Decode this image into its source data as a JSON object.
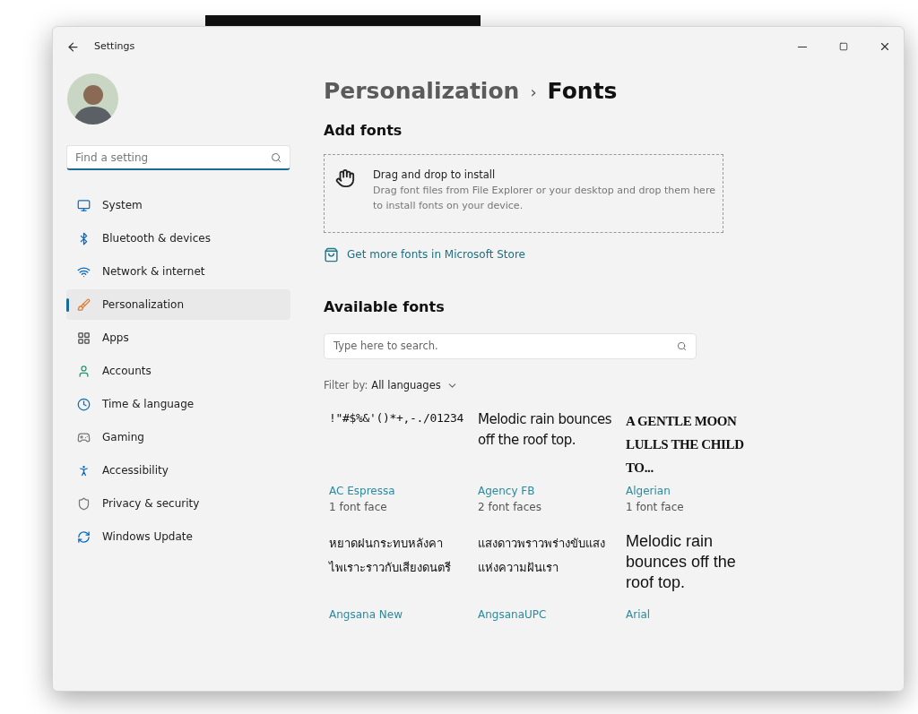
{
  "window": {
    "title": "Settings"
  },
  "search": {
    "placeholder": "Find a setting"
  },
  "sidebar": {
    "items": [
      {
        "label": "System",
        "selected": false
      },
      {
        "label": "Bluetooth & devices",
        "selected": false
      },
      {
        "label": "Network & internet",
        "selected": false
      },
      {
        "label": "Personalization",
        "selected": true
      },
      {
        "label": "Apps",
        "selected": false
      },
      {
        "label": "Accounts",
        "selected": false
      },
      {
        "label": "Time & language",
        "selected": false
      },
      {
        "label": "Gaming",
        "selected": false
      },
      {
        "label": "Accessibility",
        "selected": false
      },
      {
        "label": "Privacy & security",
        "selected": false
      },
      {
        "label": "Windows Update",
        "selected": false
      }
    ]
  },
  "breadcrumb": {
    "parent": "Personalization",
    "separator": "›",
    "current": "Fonts"
  },
  "add_fonts": {
    "heading": "Add fonts",
    "drop_title": "Drag and drop to install",
    "drop_description": "Drag font files from File Explorer or your desktop and drop them here to install fonts on your device."
  },
  "store_link": "Get more fonts in Microsoft Store",
  "available": {
    "heading": "Available fonts",
    "search_placeholder": "Type here to search.",
    "filter_label": "Filter by:",
    "filter_value": "All languages"
  },
  "fonts": [
    {
      "kind": "symbol",
      "sample": "!\"#$%&'()*+,-./01234",
      "name": "AC Espressa",
      "faces": "1 font face"
    },
    {
      "kind": "condensed",
      "sample": "Melodic rain bounces off the roof top.",
      "name": "Agency FB",
      "faces": "2 font faces"
    },
    {
      "kind": "display",
      "sample": "A GENTLE MOON LULLS THE CHILD TO...",
      "name": "Algerian",
      "faces": "1 font face"
    },
    {
      "kind": "thai",
      "sample": "หยาดฝนกระทบหลังคา ไพเราะราวกับเสียงดนตรี",
      "name": "Angsana New"
    },
    {
      "kind": "thai",
      "sample": "แสงดาวพราวพร่างขับแสง แห่งความฝันเรา",
      "name": "AngsanaUPC"
    },
    {
      "kind": "sans",
      "sample": "Melodic rain bounces off the roof top.",
      "name": "Arial"
    }
  ]
}
